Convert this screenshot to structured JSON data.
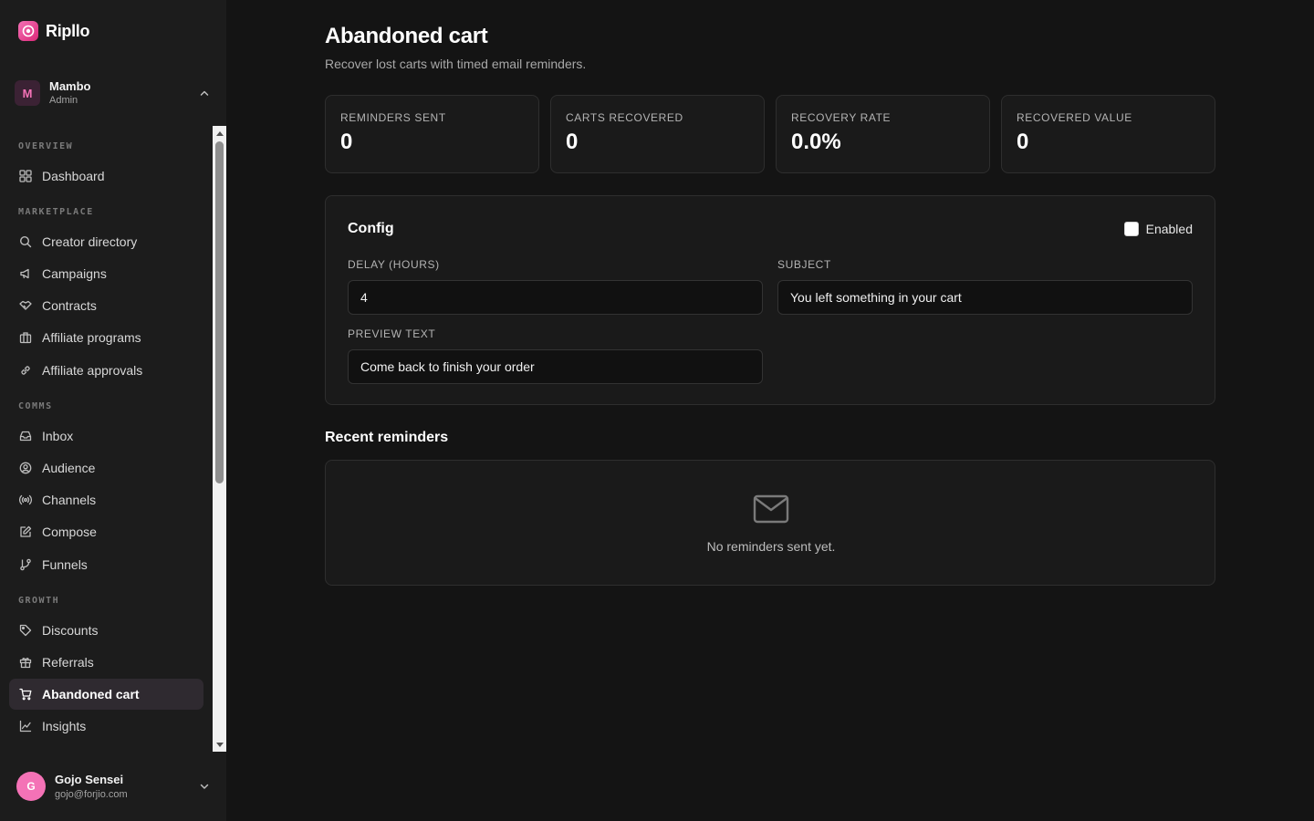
{
  "brand": {
    "name": "Ripllo",
    "accent": "#f472b6"
  },
  "workspace": {
    "initial": "M",
    "name": "Mambo",
    "role": "Admin"
  },
  "nav": {
    "sections": {
      "overview": "OVERVIEW",
      "marketplace": "MARKETPLACE",
      "comms": "COMMS",
      "growth": "GROWTH"
    },
    "items": {
      "dashboard": {
        "label": "Dashboard",
        "icon": "grid-icon"
      },
      "creator_directory": {
        "label": "Creator directory",
        "icon": "search-icon"
      },
      "campaigns": {
        "label": "Campaigns",
        "icon": "megaphone-icon"
      },
      "contracts": {
        "label": "Contracts",
        "icon": "handshake-icon"
      },
      "affiliate_programs": {
        "label": "Affiliate programs",
        "icon": "briefcase-icon"
      },
      "affiliate_approvals": {
        "label": "Affiliate approvals",
        "icon": "link-icon"
      },
      "inbox": {
        "label": "Inbox",
        "icon": "inbox-icon"
      },
      "audience": {
        "label": "Audience",
        "icon": "user-circle-icon"
      },
      "channels": {
        "label": "Channels",
        "icon": "radio-icon"
      },
      "compose": {
        "label": "Compose",
        "icon": "edit-icon"
      },
      "funnels": {
        "label": "Funnels",
        "icon": "git-branch-icon"
      },
      "discounts": {
        "label": "Discounts",
        "icon": "tag-icon"
      },
      "referrals": {
        "label": "Referrals",
        "icon": "gift-icon"
      },
      "abandoned_cart": {
        "label": "Abandoned cart",
        "icon": "cart-icon",
        "active": true
      },
      "insights": {
        "label": "Insights",
        "icon": "chart-line-icon"
      }
    }
  },
  "user": {
    "initial": "G",
    "name": "Gojo Sensei",
    "email": "gojo@forjio.com"
  },
  "page": {
    "title": "Abandoned cart",
    "subtitle": "Recover lost carts with timed email reminders."
  },
  "stats": [
    {
      "label": "REMINDERS SENT",
      "value": "0"
    },
    {
      "label": "CARTS RECOVERED",
      "value": "0"
    },
    {
      "label": "RECOVERY RATE",
      "value": "0.0%"
    },
    {
      "label": "RECOVERED VALUE",
      "value": "0"
    }
  ],
  "config": {
    "title": "Config",
    "enabled_label": "Enabled",
    "enabled": false,
    "delay": {
      "label": "DELAY (HOURS)",
      "value": "4"
    },
    "subject": {
      "label": "SUBJECT",
      "value": "You left something in your cart"
    },
    "preview": {
      "label": "PREVIEW TEXT",
      "value": "Come back to finish your order"
    }
  },
  "recent": {
    "title": "Recent reminders",
    "empty_text": "No reminders sent yet.",
    "icon": "mail-icon"
  }
}
